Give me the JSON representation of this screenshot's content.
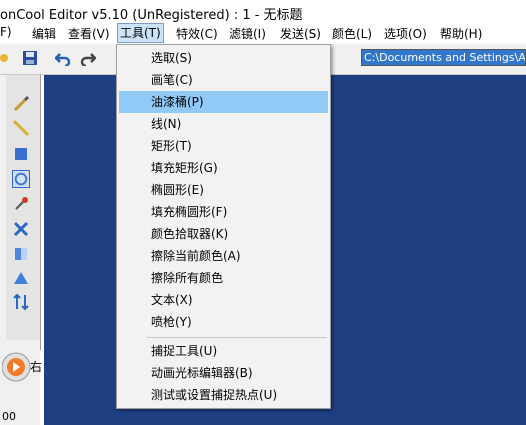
{
  "window": {
    "title": "onCool Editor v5.10 (UnRegistered) : 1 - 无标题"
  },
  "menubar": {
    "items": [
      {
        "label": "F)"
      },
      {
        "label": "编辑"
      },
      {
        "label": "查看(V)"
      },
      {
        "label": "工具(T)"
      },
      {
        "label": "特效(C)"
      },
      {
        "label": "滤镜(I)"
      },
      {
        "label": "发送(S)"
      },
      {
        "label": "颜色(L)"
      },
      {
        "label": "选项(O)"
      },
      {
        "label": "帮助(H)"
      }
    ]
  },
  "toolbar": {
    "path_value": "C:\\Documents and Settings\\Admin"
  },
  "tools_menu": {
    "items": [
      {
        "label": "选取(S)"
      },
      {
        "label": "画笔(C)"
      },
      {
        "label": "油漆桶(P)"
      },
      {
        "label": "线(N)"
      },
      {
        "label": "矩形(T)"
      },
      {
        "label": "填充矩形(G)"
      },
      {
        "label": "椭圆形(E)"
      },
      {
        "label": "填充椭圆形(F)"
      },
      {
        "label": "颜色拾取器(K)"
      },
      {
        "label": "擦除当前颜色(A)"
      },
      {
        "label": "擦除所有颜色"
      },
      {
        "label": "文本(X)"
      },
      {
        "label": "喷枪(Y)"
      },
      {
        "label": "捕捉工具(U)"
      },
      {
        "label": "动画光标编辑器(B)"
      },
      {
        "label": "测试或设置捕捉热点(U)"
      }
    ],
    "highlighted": "油漆桶(P)"
  },
  "side": {
    "label": "右",
    "number": "00"
  },
  "colors": {
    "canvas": "#1e3f82",
    "highlight": "#91c9f7",
    "path_bg": "#3377cc"
  }
}
